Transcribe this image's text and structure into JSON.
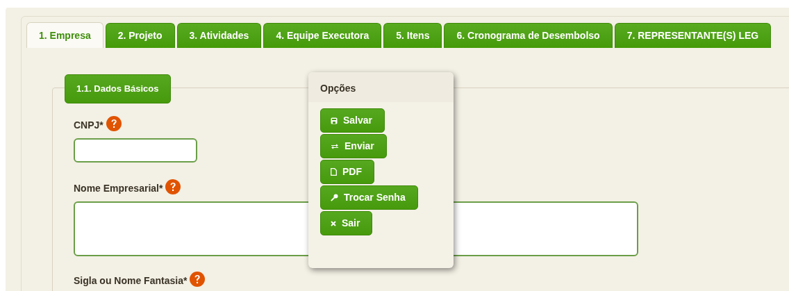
{
  "tabs": [
    {
      "label": "1. Empresa",
      "selected": true
    },
    {
      "label": "2. Projeto",
      "selected": false
    },
    {
      "label": "3. Atividades",
      "selected": false
    },
    {
      "label": "4. Equipe Executora",
      "selected": false
    },
    {
      "label": "5. Itens",
      "selected": false
    },
    {
      "label": "6. Cronograma de Desembolso",
      "selected": false
    },
    {
      "label": "7. REPRESENTANTE(S) LEG",
      "selected": false
    }
  ],
  "section": {
    "legend": "1.1. Dados Básicos"
  },
  "fields": [
    {
      "label": "CNPJ*",
      "kind": "input"
    },
    {
      "label": "Nome Empresarial*",
      "kind": "textarea"
    },
    {
      "label": "Sigla ou Nome Fantasia*",
      "kind": "label_only"
    }
  ],
  "options_panel": {
    "title": "Opções",
    "buttons": [
      {
        "label": "Salvar",
        "kind": "save"
      },
      {
        "label": "Enviar",
        "kind": "send"
      },
      {
        "label": "PDF",
        "kind": "pdf"
      },
      {
        "label": "Trocar Senha",
        "kind": "password"
      },
      {
        "label": "Sair",
        "kind": "exit"
      }
    ]
  }
}
